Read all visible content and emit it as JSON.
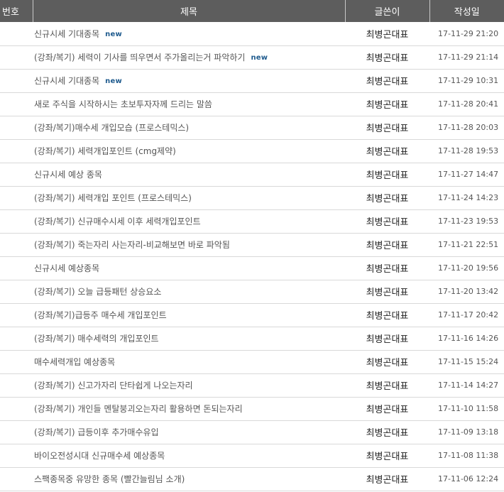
{
  "table": {
    "headers": {
      "num": "번호",
      "title": "제목",
      "author": "글쓴이",
      "date": "작성일"
    },
    "new_label": "new",
    "rows": [
      {
        "num": "",
        "title": "신규시세 기대종목",
        "is_new": true,
        "author": "최병곤대표",
        "date": "17-11-29 21:20"
      },
      {
        "num": "",
        "title": "(강좌/복기) 세력이 기사를 띄우면서 주가올리는거 파악하기",
        "is_new": true,
        "author": "최병곤대표",
        "date": "17-11-29 21:14"
      },
      {
        "num": "",
        "title": "신규시세 기대종목",
        "is_new": true,
        "author": "최병곤대표",
        "date": "17-11-29 10:31"
      },
      {
        "num": "",
        "title": "새로 주식을 시작하시는 초보투자자께 드리는 말씀",
        "is_new": false,
        "author": "최병곤대표",
        "date": "17-11-28 20:41"
      },
      {
        "num": "",
        "title": "(강좌/복기)매수세 개입모습 (프로스테믹스)",
        "is_new": false,
        "author": "최병곤대표",
        "date": "17-11-28 20:03"
      },
      {
        "num": "",
        "title": "(강좌/복기) 세력개입포인트 (cmg제약)",
        "is_new": false,
        "author": "최병곤대표",
        "date": "17-11-28 19:53"
      },
      {
        "num": "",
        "title": "신규시세 예상 종목",
        "is_new": false,
        "author": "최병곤대표",
        "date": "17-11-27 14:47"
      },
      {
        "num": "",
        "title": "(강좌/복기) 세력개입 포인트 (프로스테믹스)",
        "is_new": false,
        "author": "최병곤대표",
        "date": "17-11-24 14:23"
      },
      {
        "num": "",
        "title": "(강좌/복기) 신규매수시세 이후 세력개입포인트",
        "is_new": false,
        "author": "최병곤대표",
        "date": "17-11-23 19:53"
      },
      {
        "num": "",
        "title": "(강좌/복기) 죽는자리 사는자리-비교해보면 바로 파악됨",
        "is_new": false,
        "author": "최병곤대표",
        "date": "17-11-21 22:51"
      },
      {
        "num": "",
        "title": "신규시세 예상종목",
        "is_new": false,
        "author": "최병곤대표",
        "date": "17-11-20 19:56"
      },
      {
        "num": "",
        "title": "(강좌/복기) 오늘 급등패턴 상승요소",
        "is_new": false,
        "author": "최병곤대표",
        "date": "17-11-20 13:42"
      },
      {
        "num": "",
        "title": "(강좌/복기)급등주 매수세 개입포인트",
        "is_new": false,
        "author": "최병곤대표",
        "date": "17-11-17 20:42"
      },
      {
        "num": "",
        "title": "(강좌/복기) 매수세력의 개입포인트",
        "is_new": false,
        "author": "최병곤대표",
        "date": "17-11-16 14:26"
      },
      {
        "num": "",
        "title": "매수세력개입 예상종목",
        "is_new": false,
        "author": "최병곤대표",
        "date": "17-11-15 15:24"
      },
      {
        "num": "",
        "title": "(강좌/복기) 신고가자리 단타쉽게 나오는자리",
        "is_new": false,
        "author": "최병곤대표",
        "date": "17-11-14 14:27"
      },
      {
        "num": "",
        "title": "(강좌/복기) 개인들 멘탈붕괴오는자리 활용하면 돈되는자리",
        "is_new": false,
        "author": "최병곤대표",
        "date": "17-11-10 11:58"
      },
      {
        "num": "",
        "title": "(강좌/복기) 급등이후 추가매수유입",
        "is_new": false,
        "author": "최병곤대표",
        "date": "17-11-09 13:18"
      },
      {
        "num": "",
        "title": "바이오전성시대 신규매수세 예상종목",
        "is_new": false,
        "author": "최병곤대표",
        "date": "17-11-08 11:38"
      },
      {
        "num": "",
        "title": "스팩종목중 유망한 종목 (빨간늘림님 소개)",
        "is_new": false,
        "author": "최병곤대표",
        "date": "17-11-06 12:24"
      }
    ]
  }
}
